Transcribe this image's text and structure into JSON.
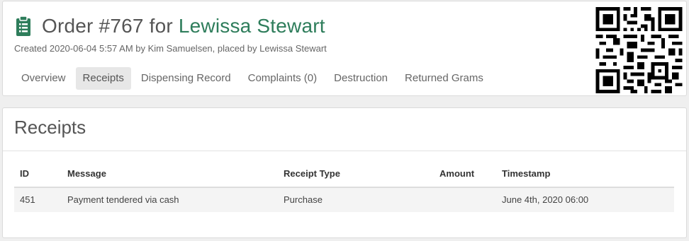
{
  "header": {
    "title_prefix": "Order #767 for ",
    "customer_name": "Lewissa Stewart",
    "created_line": "Created 2020-06-04 5:57 AM by Kim Samuelsen, placed by Lewissa Stewart",
    "icon": "clipboard-icon",
    "tabs": [
      {
        "label": "Overview",
        "active": false
      },
      {
        "label": "Receipts",
        "active": true
      },
      {
        "label": "Dispensing Record",
        "active": false
      },
      {
        "label": "Complaints (0)",
        "active": false
      },
      {
        "label": "Destruction",
        "active": false
      },
      {
        "label": "Returned Grams",
        "active": false
      }
    ]
  },
  "receipts": {
    "title": "Receipts",
    "columns": [
      "ID",
      "Message",
      "Receipt Type",
      "Amount",
      "Timestamp"
    ],
    "rows": [
      {
        "id": "451",
        "message": "Payment tendered via cash",
        "type": "Purchase",
        "amount": "",
        "timestamp": "June 4th, 2020 06:00"
      }
    ]
  },
  "colors": {
    "accent": "#2e7d5b",
    "active_tab_bg": "#e7e7e7",
    "row_bg": "#f4f4f4"
  }
}
